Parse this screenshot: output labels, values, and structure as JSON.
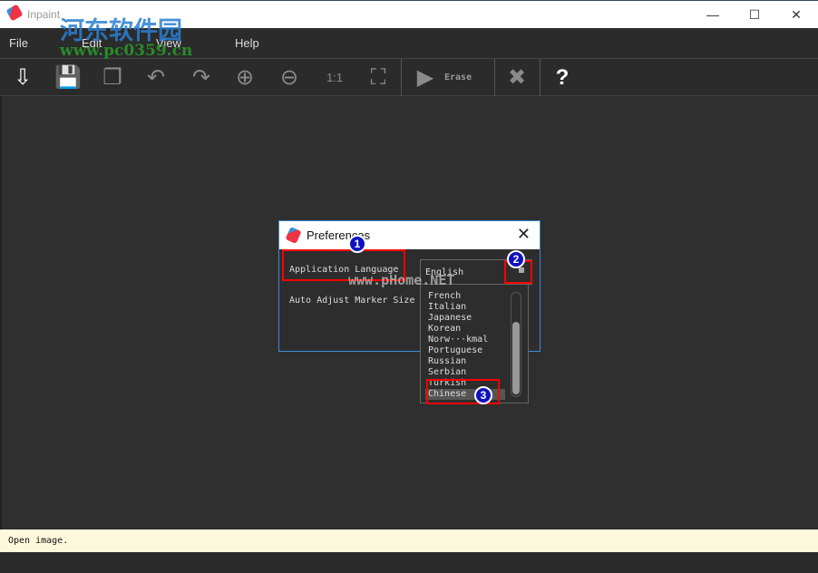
{
  "window": {
    "title": "Inpaint",
    "minimize": "—",
    "maximize": "☐",
    "close": "✕"
  },
  "menu": [
    "File",
    "Edit",
    "View",
    "Help"
  ],
  "toolbar": {
    "erase_label": "Erase",
    "tools": [
      "open-image",
      "save",
      "preview",
      "undo",
      "redo",
      "zoom-in",
      "zoom-out",
      "zoom-1-1",
      "zoom-fit"
    ],
    "cancel": "✖",
    "help": "?"
  },
  "dialog": {
    "title": "Preferences",
    "close": "✕",
    "language_label": "Application Language",
    "marker_label": "Auto Adjust Marker Size",
    "language_value": "English",
    "options": [
      "French",
      "Italian",
      "Japanese",
      "Korean",
      "Norw···kmal",
      "Portuguese",
      "Russian",
      "Serbian",
      "Turkish",
      "Chinese"
    ],
    "selected": "Chinese"
  },
  "annotations": [
    "1",
    "2",
    "3"
  ],
  "watermarks": {
    "site1": "河东软件园",
    "site2": "www.pc0359.cn",
    "site3": "www.pHome.NET"
  },
  "status": "Open image."
}
